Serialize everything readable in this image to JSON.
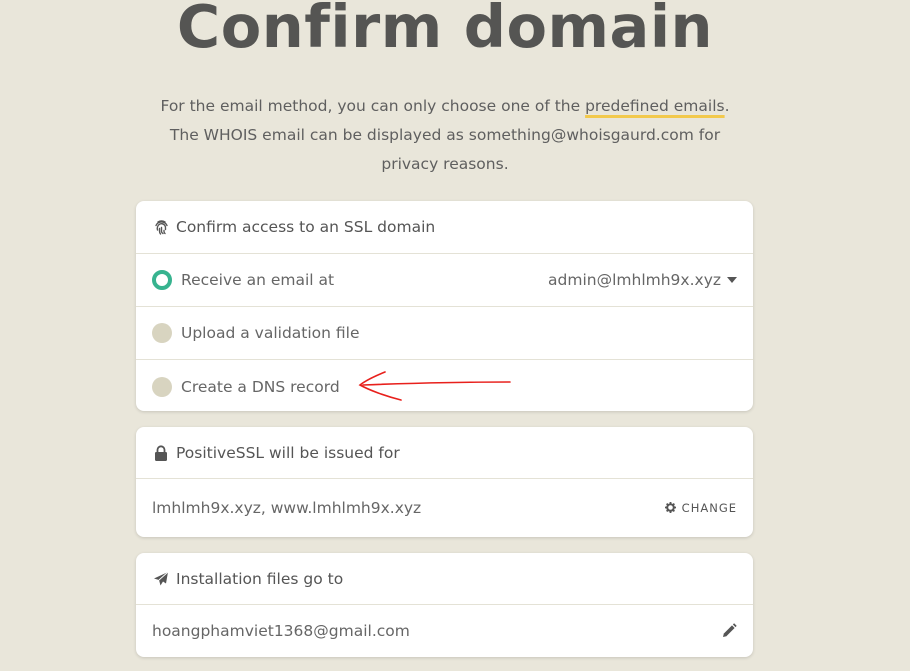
{
  "page": {
    "title": "Confirm domain",
    "intro_before": "For the email method, you can only choose one of the ",
    "intro_link": "predefined emails",
    "intro_after": ". The WHOIS email can be displayed as something@whoisgaurd.com for privacy reasons."
  },
  "confirm_card": {
    "heading": "Confirm access to an SSL domain",
    "heading_icon": "fingerprint-icon",
    "options": [
      {
        "label": "Receive an email at",
        "selected": true,
        "value": "admin@lmhlmh9x.xyz"
      },
      {
        "label": "Upload a validation file",
        "selected": false
      },
      {
        "label": "Create a DNS record",
        "selected": false
      }
    ]
  },
  "issued_card": {
    "heading": "PositiveSSL will be issued for",
    "heading_icon": "lock-icon",
    "domains": "lmhlmh9x.xyz, www.lmhlmh9x.xyz",
    "change_label": "CHANGE",
    "change_icon": "gear-icon"
  },
  "install_card": {
    "heading": "Installation files go to",
    "heading_icon": "paper-plane-icon",
    "email": "hoangphamviet1368@gmail.com",
    "edit_icon": "pencil-icon"
  },
  "colors": {
    "background": "#e9e6da",
    "accent_green": "#37b38f",
    "underline_yellow": "#f2c94c",
    "annotation_red": "#e8201c"
  }
}
